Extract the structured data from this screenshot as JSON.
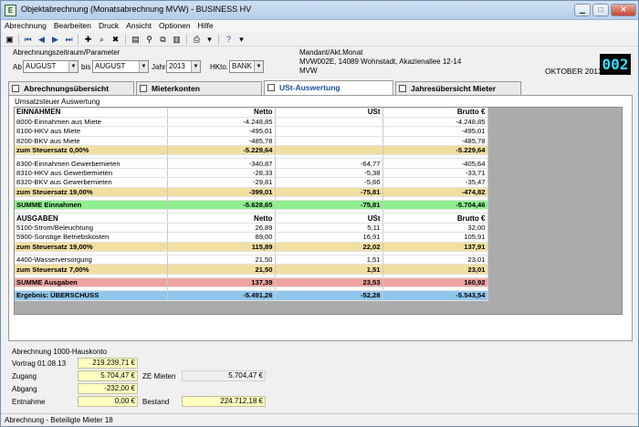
{
  "window": {
    "title": "Objektabrechnung (Monatsabrechnung MVW) - BUSINESS HV"
  },
  "menu": [
    "Abrechnung",
    "Bearbeiten",
    "Druck",
    "Ansicht",
    "Optionen",
    "Hilfe"
  ],
  "params": {
    "group_label": "Abrechnungszeitraum/Parameter",
    "ab_label": "Ab",
    "ab_value": "AUGUST",
    "bis_label": "bis",
    "bis_value": "AUGUST",
    "jahr_label": "Jahr",
    "jahr_value": "2013",
    "hkto_label": "HKto.",
    "hkto_value": "BANK"
  },
  "mandant": {
    "label": "Mandant/Akt.Monat",
    "line1": "MVW002E, 14089 Wohnstadt, Akazienallee 12-14",
    "line2": "MVW",
    "month": "OKTOBER 2013",
    "counter": "002"
  },
  "tabs": [
    "Abrechnungsübersicht",
    "Mieterkonten",
    "USt-Auswertung",
    "Jahresübersicht Mieter"
  ],
  "group_caption": "Umsatzsteuer Auswertung",
  "table": [
    {
      "t": "head",
      "c": [
        "EINNAHMEN",
        "Netto",
        "USt",
        "Brutto €"
      ]
    },
    {
      "t": "row",
      "c": [
        "8000-Einnahmen aus Miete",
        "-4.248,85",
        "",
        "-4.248,85"
      ]
    },
    {
      "t": "row",
      "c": [
        "8100-HKV aus Miete",
        "-495,01",
        "",
        "-495,01"
      ]
    },
    {
      "t": "row",
      "c": [
        "8200-BKV aus Miete",
        "-485,78",
        "",
        "-485,78"
      ]
    },
    {
      "t": "sub",
      "c": [
        "zum Steuersatz  0,00%",
        "-5.229,64",
        "",
        "-5.229,64"
      ]
    },
    {
      "t": "gap",
      "c": [
        "",
        "",
        "",
        ""
      ]
    },
    {
      "t": "row",
      "c": [
        "8300-Einnahmen Gewerbemieten",
        "-340,87",
        "-64,77",
        "-405,64"
      ]
    },
    {
      "t": "row",
      "c": [
        "8310-HKV aus Gewerbemieten",
        "-28,33",
        "-5,38",
        "-33,71"
      ]
    },
    {
      "t": "row",
      "c": [
        "8320-BKV aus Gewerbemieten",
        "-29,81",
        "-5,66",
        "-35,47"
      ]
    },
    {
      "t": "sub",
      "c": [
        "zum Steuersatz  19,00%",
        "-399,01",
        "-75,81",
        "-474,82"
      ]
    },
    {
      "t": "gap",
      "c": [
        "",
        "",
        "",
        ""
      ]
    },
    {
      "t": "sumE",
      "c": [
        "SUMME Einnahmen",
        "-5.628,65",
        "-75,81",
        "-5.704,46"
      ]
    },
    {
      "t": "gap",
      "c": [
        "",
        "",
        "",
        ""
      ]
    },
    {
      "t": "head",
      "c": [
        "AUSGABEN",
        "Netto",
        "USt",
        "Brutto €"
      ]
    },
    {
      "t": "row",
      "c": [
        "5100-Strom/Beleuchtung",
        "26,89",
        "5,11",
        "32,00"
      ]
    },
    {
      "t": "row",
      "c": [
        "5900-Sonstige Betriebskosten",
        "89,00",
        "16,91",
        "105,91"
      ]
    },
    {
      "t": "sub",
      "c": [
        "zum Steuersatz  19,00%",
        "115,89",
        "22,02",
        "137,91"
      ]
    },
    {
      "t": "gap",
      "c": [
        "",
        "",
        "",
        ""
      ]
    },
    {
      "t": "row",
      "c": [
        "4400-Wasserversorgung",
        "21,50",
        "1,51",
        "23,01"
      ]
    },
    {
      "t": "sub",
      "c": [
        "zum Steuersatz  7,00%",
        "21,50",
        "1,51",
        "23,01"
      ]
    },
    {
      "t": "gap",
      "c": [
        "",
        "",
        "",
        ""
      ]
    },
    {
      "t": "sumA",
      "c": [
        "SUMME Ausgaben",
        "137,39",
        "23,53",
        "160,92"
      ]
    },
    {
      "t": "gap",
      "c": [
        "",
        "",
        "",
        ""
      ]
    },
    {
      "t": "res",
      "c": [
        "Ergebnis: ÜBERSCHUSS",
        "-5.491,26",
        "-52,28",
        "-5.543,54"
      ]
    }
  ],
  "konto": {
    "title": "Abrechnung 1000-Hauskonto",
    "vortrag_label": "Vortrag 01.08.13",
    "vortrag_value": "219.239,71 €",
    "zugang_label": "Zugang",
    "zugang_value": "5.704,47 €",
    "ze_label": "ZE Mieten",
    "ze_value": "5.704,47 €",
    "abgang_label": "Abgang",
    "abgang_value": "-232,00 €",
    "entnahme_label": "Entnahme",
    "entnahme_value": "0,00 €",
    "bestand_label": "Bestand",
    "bestand_value": "224.712,18 €"
  },
  "status": "Abrechnung - Beteiligte Mieter 18"
}
